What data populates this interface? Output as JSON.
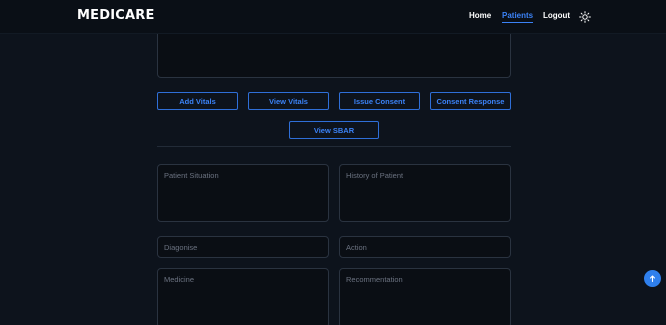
{
  "brand": "MEDICARE",
  "nav": {
    "home": "Home",
    "patients": "Patients",
    "logout": "Logout",
    "theme_icon": "sun-icon"
  },
  "actions": {
    "add_vitals": "Add Vitals",
    "view_vitals": "View Vitals",
    "issue_consent": "Issue Consent",
    "consent_response": "Consent Response",
    "view_sbar": "View SBAR"
  },
  "form": {
    "patient_situation": "Patient Situation",
    "history_of_patient": "History of Patient",
    "diagonise": "Diagonise",
    "action": "Action",
    "medicine": "Medicine",
    "recommentation": "Recommentation"
  },
  "fab_icon": "scroll-up-icon",
  "colors": {
    "background": "#0d131c",
    "navbar": "#0a0f16",
    "accent": "#3b82f6",
    "field_border": "#2a3340",
    "placeholder": "#6b7280"
  }
}
